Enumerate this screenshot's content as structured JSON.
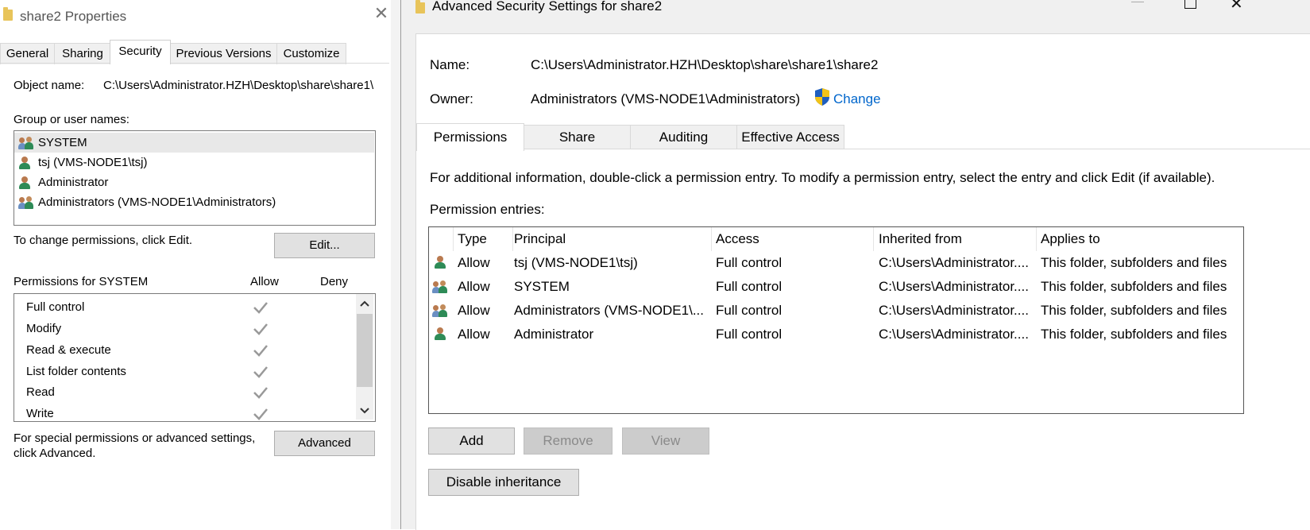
{
  "left_window": {
    "title": "share2 Properties",
    "close_glyph": "✕",
    "tabs": [
      "General",
      "Sharing",
      "Security",
      "Previous Versions",
      "Customize"
    ],
    "active_tab": "Security",
    "object_name_label": "Object name:",
    "object_name_value": "C:\\Users\\Administrator.HZH\\Desktop\\share\\share1\\",
    "group_label": "Group or user names:",
    "users": [
      {
        "name": "SYSTEM",
        "icon": "group-icon",
        "selected": true
      },
      {
        "name": "tsj (VMS-NODE1\\tsj)",
        "icon": "user-icon",
        "selected": false
      },
      {
        "name": "Administrator",
        "icon": "user-icon",
        "selected": false
      },
      {
        "name": "Administrators (VMS-NODE1\\Administrators)",
        "icon": "group-icon",
        "selected": false
      }
    ],
    "change_hint": "To change permissions, click Edit.",
    "edit_button": "Edit...",
    "permissions_for": "Permissions for SYSTEM",
    "allow_header": "Allow",
    "deny_header": "Deny",
    "permissions": [
      {
        "name": "Full control",
        "allow": true,
        "deny": false
      },
      {
        "name": "Modify",
        "allow": true,
        "deny": false
      },
      {
        "name": "Read & execute",
        "allow": true,
        "deny": false
      },
      {
        "name": "List folder contents",
        "allow": true,
        "deny": false
      },
      {
        "name": "Read",
        "allow": true,
        "deny": false
      },
      {
        "name": "Write",
        "allow": true,
        "deny": false
      }
    ],
    "special_hint_line1": "For special permissions or advanced settings,",
    "special_hint_line2": "click Advanced.",
    "advanced_button": "Advanced"
  },
  "right_window": {
    "title": "Advanced Security Settings for share2",
    "name_label": "Name:",
    "name_value": "C:\\Users\\Administrator.HZH\\Desktop\\share\\share1\\share2",
    "owner_label": "Owner:",
    "owner_value": "Administrators (VMS-NODE1\\Administrators)",
    "change_link": "Change",
    "tabs": [
      "Permissions",
      "Share",
      "Auditing",
      "Effective Access"
    ],
    "active_tab": "Permissions",
    "info_text": "For additional information, double-click a permission entry. To modify a permission entry, select the entry and click Edit (if available).",
    "entries_label": "Permission entries:",
    "columns": [
      "Type",
      "Principal",
      "Access",
      "Inherited from",
      "Applies to"
    ],
    "entries": [
      {
        "icon": "user-icon",
        "type": "Allow",
        "principal": "tsj (VMS-NODE1\\tsj)",
        "access": "Full control",
        "inherited": "C:\\Users\\Administrator....",
        "applies": "This folder, subfolders and files"
      },
      {
        "icon": "group-icon",
        "type": "Allow",
        "principal": "SYSTEM",
        "access": "Full control",
        "inherited": "C:\\Users\\Administrator....",
        "applies": "This folder, subfolders and files"
      },
      {
        "icon": "group-icon",
        "type": "Allow",
        "principal": "Administrators (VMS-NODE1\\...",
        "access": "Full control",
        "inherited": "C:\\Users\\Administrator....",
        "applies": "This folder, subfolders and files"
      },
      {
        "icon": "user-icon",
        "type": "Allow",
        "principal": "Administrator",
        "access": "Full control",
        "inherited": "C:\\Users\\Administrator....",
        "applies": "This folder, subfolders and files"
      }
    ],
    "add_button": "Add",
    "remove_button": "Remove",
    "view_button": "View",
    "disable_inheritance_button": "Disable inheritance"
  },
  "colors": {
    "link": "#0066cc",
    "selection": "#e8e8e8",
    "button_bg": "#e1e1e1",
    "disabled_button_bg": "#cccccc"
  }
}
